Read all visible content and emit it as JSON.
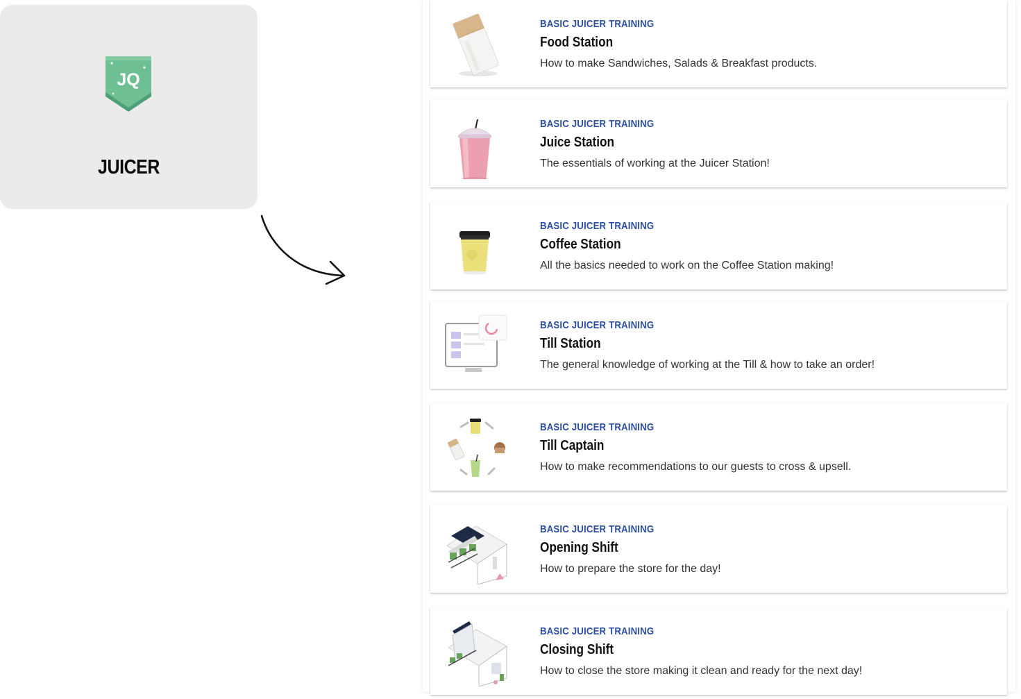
{
  "badge": {
    "initials": "JQ",
    "title": "JUICER",
    "colors": {
      "shield": "#6fbf94",
      "shield_dark": "#4f9f76",
      "card_bg": "#ebebeb"
    }
  },
  "accent": "#2b4ea2",
  "modules": [
    {
      "category": "BASIC JUICER TRAINING",
      "title": "Food Station",
      "description": "How to make Sandwiches, Salads & Breakfast products.",
      "icon": "food-bag-icon"
    },
    {
      "category": "BASIC JUICER TRAINING",
      "title": "Juice Station",
      "description": "The essentials of working at the Juicer Station!",
      "icon": "juice-cup-icon"
    },
    {
      "category": "BASIC JUICER TRAINING",
      "title": "Coffee Station",
      "description": "All the basics needed to work on the Coffee Station making!",
      "icon": "coffee-cup-icon"
    },
    {
      "category": "BASIC JUICER TRAINING",
      "title": "Till Station",
      "description": "The general knowledge of working at the Till & how to take an order!",
      "icon": "till-monitor-icon"
    },
    {
      "category": "BASIC JUICER TRAINING",
      "title": "Till Captain",
      "description": "How to make recommendations to our guests to cross & upsell.",
      "icon": "upsell-cycle-icon"
    },
    {
      "category": "BASIC JUICER TRAINING",
      "title": "Opening Shift",
      "description": "How to prepare the store for the day!",
      "icon": "store-front-icon"
    },
    {
      "category": "BASIC JUICER TRAINING",
      "title": "Closing Shift",
      "description": "How to close the store making it clean and ready for the next day!",
      "icon": "store-closed-icon"
    }
  ]
}
